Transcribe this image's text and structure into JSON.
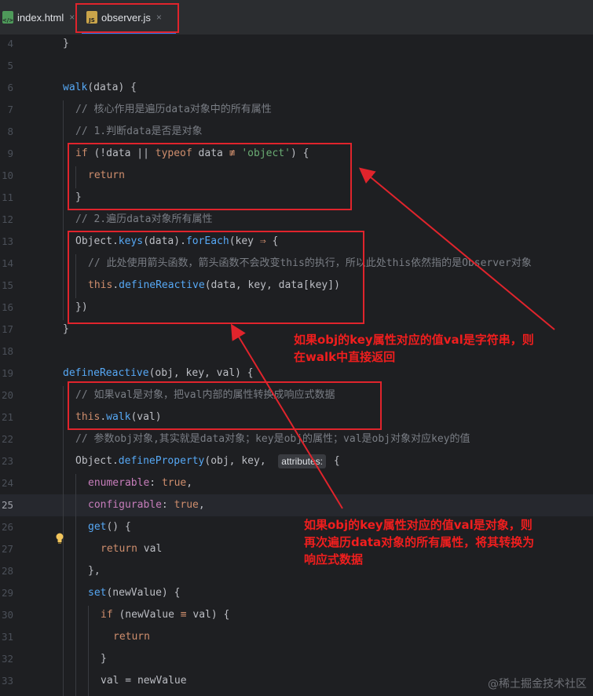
{
  "tabs": [
    {
      "icon_text": "</>",
      "label": "index.html",
      "close": "×"
    },
    {
      "icon_text": "JS",
      "label": "observer.js",
      "close": "×"
    }
  ],
  "lines": [
    {
      "n": "4",
      "html": "<span class=\"code\" style=\"left:80px\">}</span>"
    },
    {
      "n": "5",
      "html": ""
    },
    {
      "n": "6",
      "html": "<span class=\"code\" style=\"left:80px\"><span class=\"fn\">walk</span>(data) {</span>"
    },
    {
      "n": "7",
      "html": "<span class=\"code cm\" style=\"left:96px\">// 核心作用是遍历data对象中的所有属性</span>"
    },
    {
      "n": "8",
      "html": "<span class=\"code cm\" style=\"left:96px\">// 1.判断data是否是对象</span>"
    },
    {
      "n": "9",
      "html": "<span class=\"code\" style=\"left:96px\"><span class=\"kw\">if</span> (!data || <span class=\"kw\">typeof</span> data <span class=\"kw\">≢</span> <span class=\"str\">'object'</span>) {</span>"
    },
    {
      "n": "10",
      "html": "<span class=\"code kw\" style=\"left:112px\">return</span>"
    },
    {
      "n": "11",
      "html": "<span class=\"code\" style=\"left:96px\">}</span>"
    },
    {
      "n": "12",
      "html": "<span class=\"code cm\" style=\"left:96px\">// 2.遍历data对象所有属性</span>"
    },
    {
      "n": "13",
      "html": "<span class=\"code\" style=\"left:96px\">Object.<span class=\"fn\">keys</span>(data).<span class=\"fn\">forEach</span>(key <span class=\"kw\">⇒</span> {</span>"
    },
    {
      "n": "14",
      "html": "<span class=\"code cm\" style=\"left:112px\">// 此处使用箭头函数，箭头函数不会改变this的执行，所以此处this依然指的是Observer对象</span>"
    },
    {
      "n": "15",
      "html": "<span class=\"code\" style=\"left:112px\"><span class=\"kw\">this</span>.<span class=\"fn\">defineReactive</span>(data, key, data[key])</span>"
    },
    {
      "n": "16",
      "html": "<span class=\"code\" style=\"left:96px\">})</span>"
    },
    {
      "n": "17",
      "html": "<span class=\"code\" style=\"left:80px\">}</span>"
    },
    {
      "n": "18",
      "html": ""
    },
    {
      "n": "19",
      "html": "<span class=\"code\" style=\"left:80px\"><span class=\"fn\">defineReactive</span>(obj, key, val) {</span>"
    },
    {
      "n": "20",
      "html": "<span class=\"code cm\" style=\"left:96px\">// 如果val是对象，把val内部的属性转换成响应式数据</span>"
    },
    {
      "n": "21",
      "html": "<span class=\"code\" style=\"left:96px\"><span class=\"kw\">this</span>.<span class=\"fn\">walk</span>(val)</span>"
    },
    {
      "n": "22",
      "html": "<span class=\"code cm\" style=\"left:96px\">// 参数obj对象,其实就是data对象；key是obj的属性；val是obj对象对应key的值</span>"
    },
    {
      "n": "23",
      "html": "<span class=\"code\" style=\"left:96px\">Object.<span class=\"fn\">defineProperty</span>(obj, key,  <span class=\"hint\">attributes:</span> {</span>"
    },
    {
      "n": "24",
      "html": "<span class=\"code\" style=\"left:112px\"><span class=\"prop\">enumerable</span>: <span class=\"kw\">true</span>,</span>"
    },
    {
      "n": "25",
      "html": "<span class=\"code\" style=\"left:112px\"><span class=\"prop\">configurable</span>: <span class=\"kw\">true</span>,</span>"
    },
    {
      "n": "26",
      "html": "<span class=\"code\" style=\"left:112px\"><span class=\"fn\">get</span>() {</span>"
    },
    {
      "n": "27",
      "html": "<span class=\"code\" style=\"left:128px\"><span class=\"kw\">return</span> val</span>"
    },
    {
      "n": "28",
      "html": "<span class=\"code\" style=\"left:112px\">},</span>"
    },
    {
      "n": "29",
      "html": "<span class=\"code\" style=\"left:112px\"><span class=\"fn\">set</span>(newValue) {</span>"
    },
    {
      "n": "30",
      "html": "<span class=\"code\" style=\"left:128px\"><span class=\"kw\">if</span> (newValue <span class=\"kw\">≡</span> val) {</span>"
    },
    {
      "n": "31",
      "html": "<span class=\"code kw\" style=\"left:144px\">return</span>"
    },
    {
      "n": "32",
      "html": "<span class=\"code\" style=\"left:128px\">}</span>"
    },
    {
      "n": "33",
      "html": "<span class=\"code\" style=\"left:128px\">val = newValue</span>"
    }
  ],
  "current_line": "25",
  "annotations": {
    "note1": "如果obj的key属性对应的值val是字符串，则\n在walk中直接返回",
    "note2": "如果obj的key属性对应的值val是对象，则\n再次遍历data对象的所有属性，将其转换为\n响应式数据"
  },
  "watermark": "@稀土掘金技术社区",
  "colors": {
    "highlight": "#e0242c",
    "note": "#f01e1e"
  }
}
